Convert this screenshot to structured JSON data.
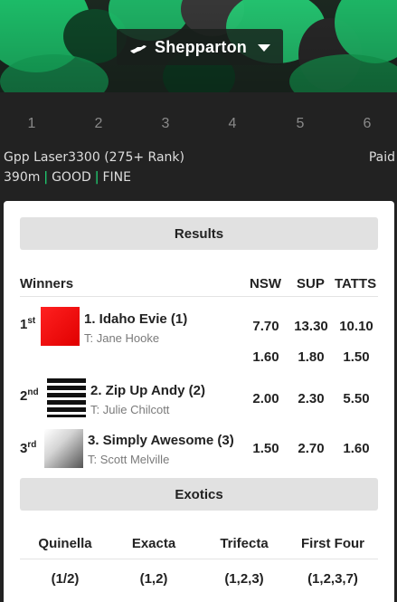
{
  "header": {
    "venue": "Shepparton",
    "venue_icon": "greyhound-icon",
    "dropdown_icon": "caret-down-icon",
    "accent_color": "#1fe07a"
  },
  "race_tabs": [
    "1",
    "2",
    "3",
    "4",
    "5",
    "6"
  ],
  "race": {
    "name": "Gpp Laser3300 (275+ Rank)",
    "status": "Paid",
    "distance": "390m",
    "track": "GOOD",
    "weather": "FINE",
    "separator": "|"
  },
  "results": {
    "title": "Results",
    "columns": {
      "winners": "Winners",
      "nsw": "NSW",
      "sup": "SUP",
      "tatts": "TATTS"
    },
    "runners": [
      {
        "place_num": "1",
        "place_suffix": "st",
        "name": "1. Idaho Evie (1)",
        "trainer": "T: Jane Hooke",
        "silk": "red",
        "win": {
          "nsw": "7.70",
          "sup": "13.30",
          "tatts": "10.10"
        },
        "place": {
          "nsw": "1.60",
          "sup": "1.80",
          "tatts": "1.50"
        }
      },
      {
        "place_num": "2",
        "place_suffix": "nd",
        "name": "2. Zip Up Andy (2)",
        "trainer": "T: Julie Chilcott",
        "silk": "black-white-stripes",
        "place": {
          "nsw": "2.00",
          "sup": "2.30",
          "tatts": "5.50"
        }
      },
      {
        "place_num": "3",
        "place_suffix": "rd",
        "name": "3. Simply Awesome (3)",
        "trainer": "T: Scott Melville",
        "silk": "white-grey-gradient",
        "place": {
          "nsw": "1.50",
          "sup": "2.70",
          "tatts": "1.60"
        }
      }
    ]
  },
  "exotics": {
    "title": "Exotics",
    "items": [
      {
        "label": "Quinella",
        "value": "(1/2)"
      },
      {
        "label": "Exacta",
        "value": "(1,2)"
      },
      {
        "label": "Trifecta",
        "value": "(1,2,3)"
      },
      {
        "label": "First Four",
        "value": "(1,2,3,7)"
      }
    ]
  }
}
